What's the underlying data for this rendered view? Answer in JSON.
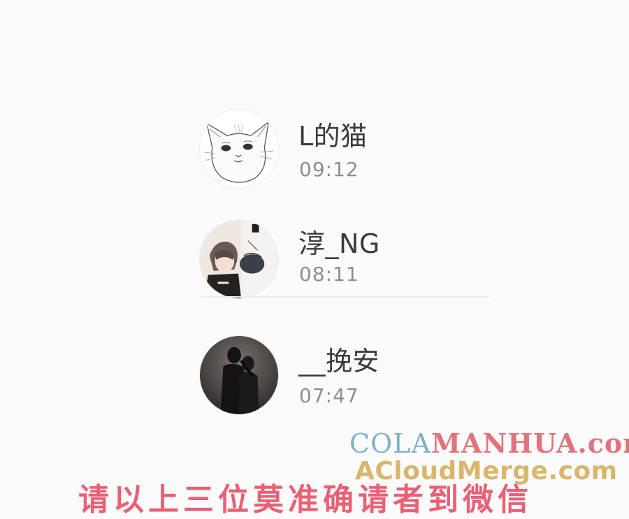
{
  "contacts": [
    {
      "name": "L的猫",
      "time": "09:12",
      "avatar": "cat-avatar"
    },
    {
      "name": "淳_NG",
      "time": "08:11",
      "avatar": "anime-couple-avatar"
    },
    {
      "name": "__挽安",
      "time": "07:47",
      "avatar": "silhouette-couple-avatar"
    }
  ],
  "watermark": {
    "line1_a": "COLA",
    "line1_b": "MANHUA.com",
    "line2": "ACloudMerge.com"
  },
  "bottom_text": "请以上三位莫准确请者到微信",
  "colors": {
    "name_text": "#3a3a3a",
    "time_text": "#8e8e8e",
    "watermark_blue": "#7fb1c6",
    "watermark_red": "#e0737c",
    "watermark_gold": "#d8b66b",
    "bottom_red": "#e7465e"
  }
}
